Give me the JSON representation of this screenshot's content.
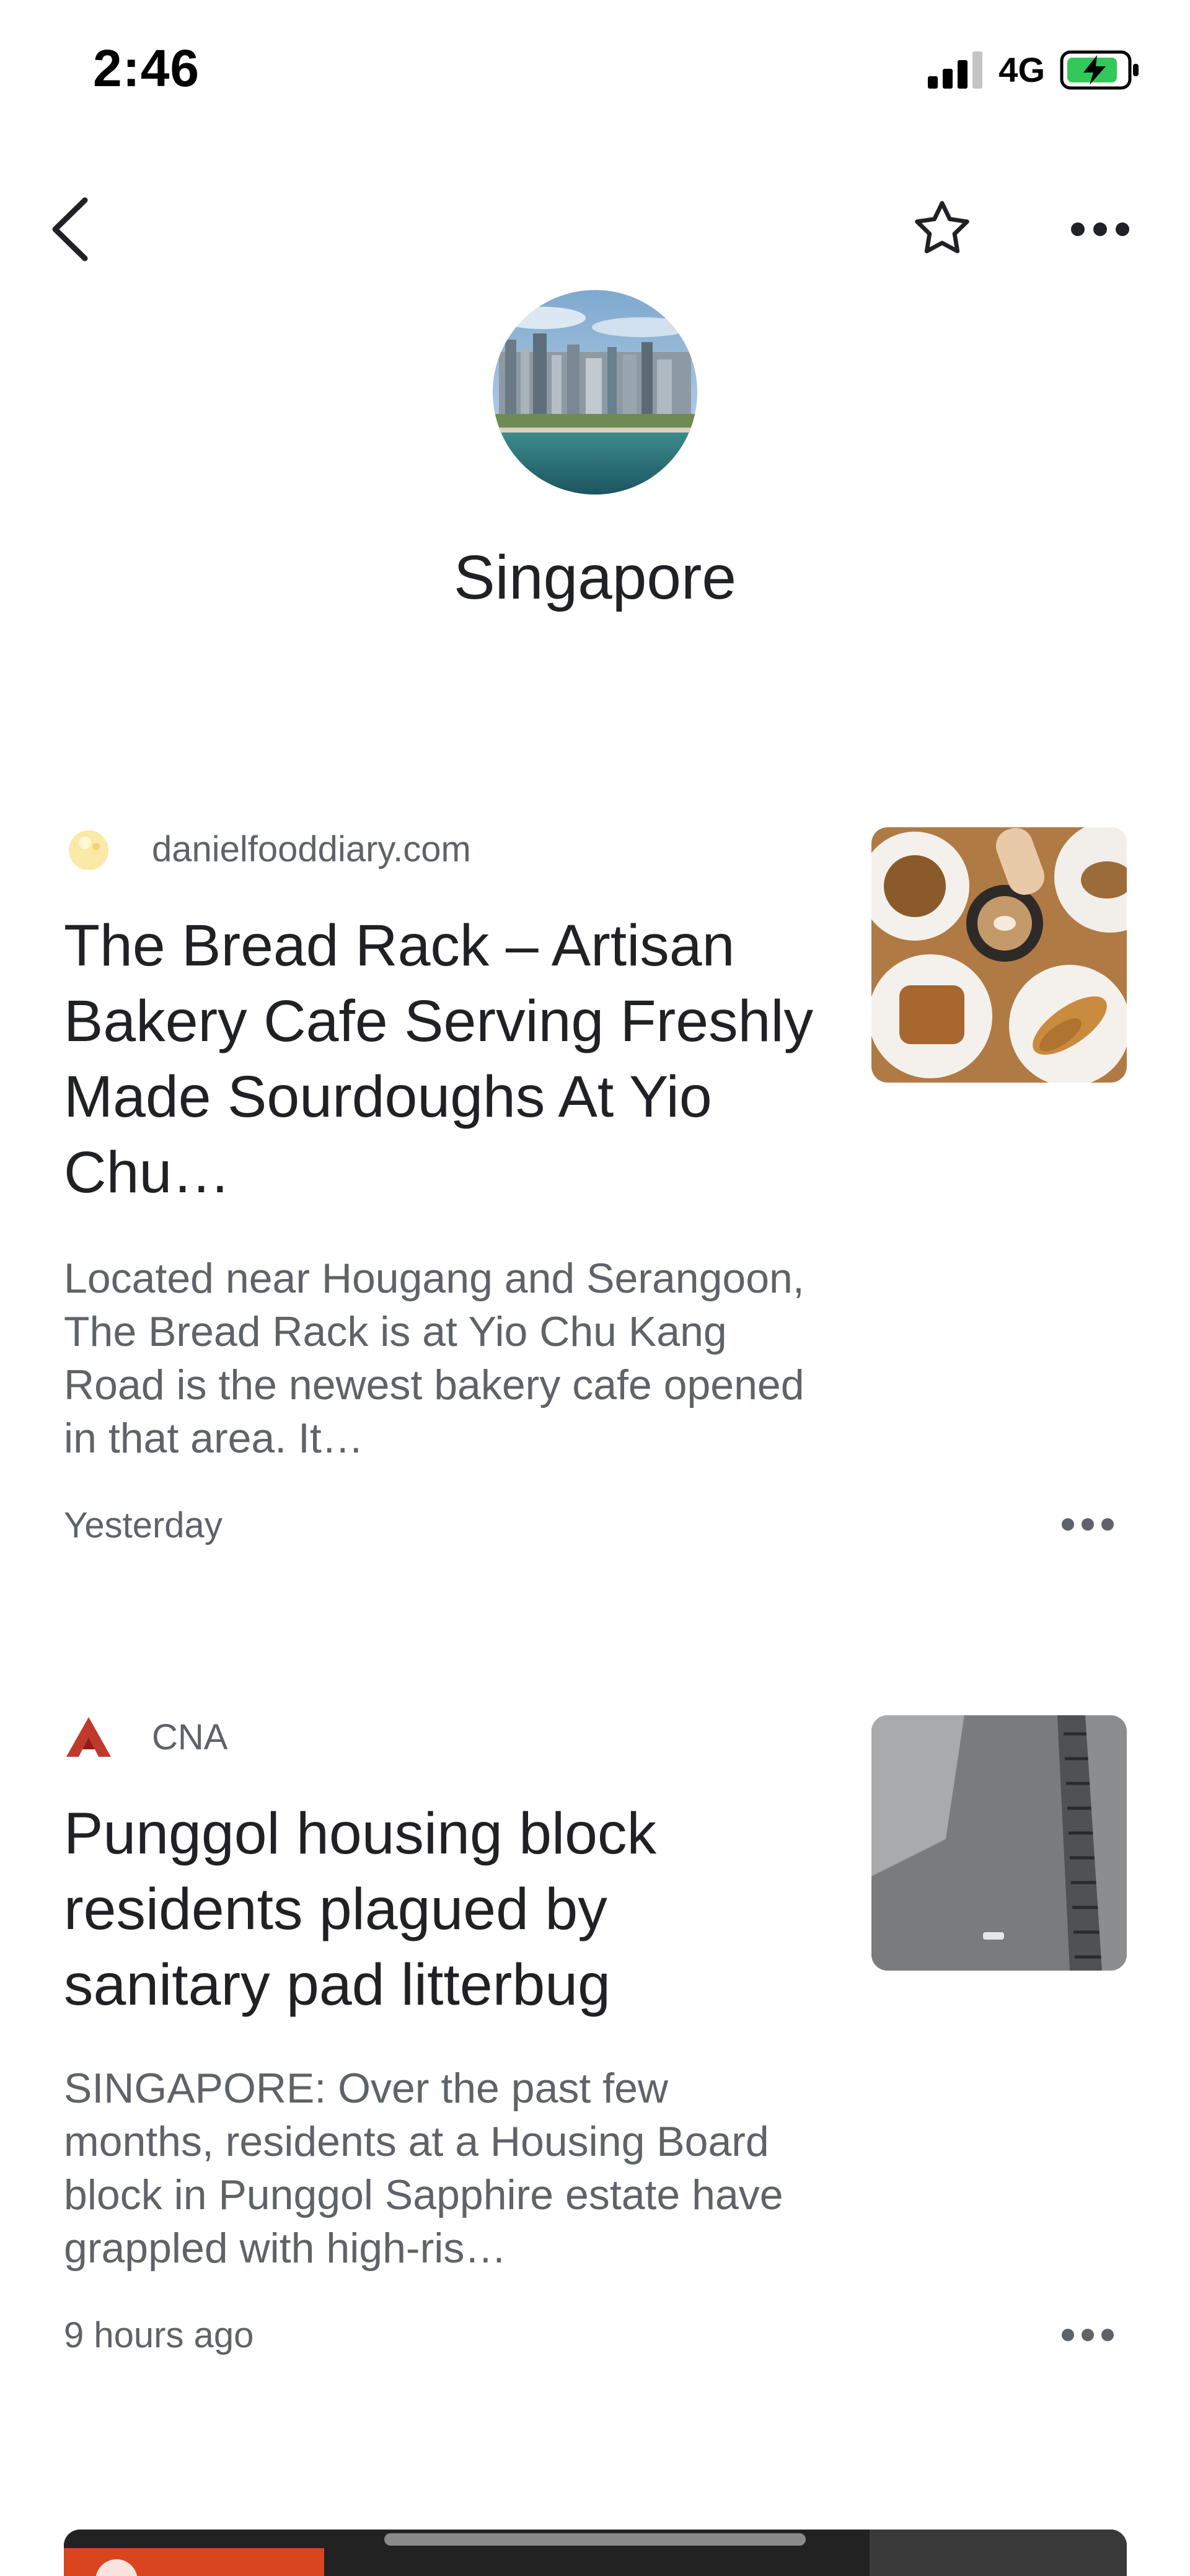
{
  "status_bar": {
    "time": "2:46",
    "network": "4G"
  },
  "app_bar": {
    "back_icon": "chevron-left-icon",
    "follow_icon": "star-outline-icon",
    "more_icon": "more-horiz-icon"
  },
  "topic": {
    "title": "Singapore"
  },
  "articles": [
    {
      "source": "danielfooddiary.com",
      "headline": "The Bread Rack – Artisan Bakery Cafe Serving Freshly Made Sourdoughs At Yio Chu…",
      "snippet": "Located near Hougang and Serangoon, The Bread Rack is at Yio Chu Kang Road is the newest bakery cafe opened in that area. It…",
      "time": "Yesterday"
    },
    {
      "source": "CNA",
      "headline": "Punggol housing block residents plagued by sanitary pad litterbug",
      "snippet": "SINGAPORE: Over the past few months, residents at a Housing Board block in Punggol Sapphire estate have grappled with high-ris…",
      "time": "9 hours ago"
    }
  ],
  "colors": {
    "text_primary": "#202124",
    "text_secondary": "#5f6368",
    "battery_charging": "#34c759",
    "cna_brand": "#c0392b"
  }
}
